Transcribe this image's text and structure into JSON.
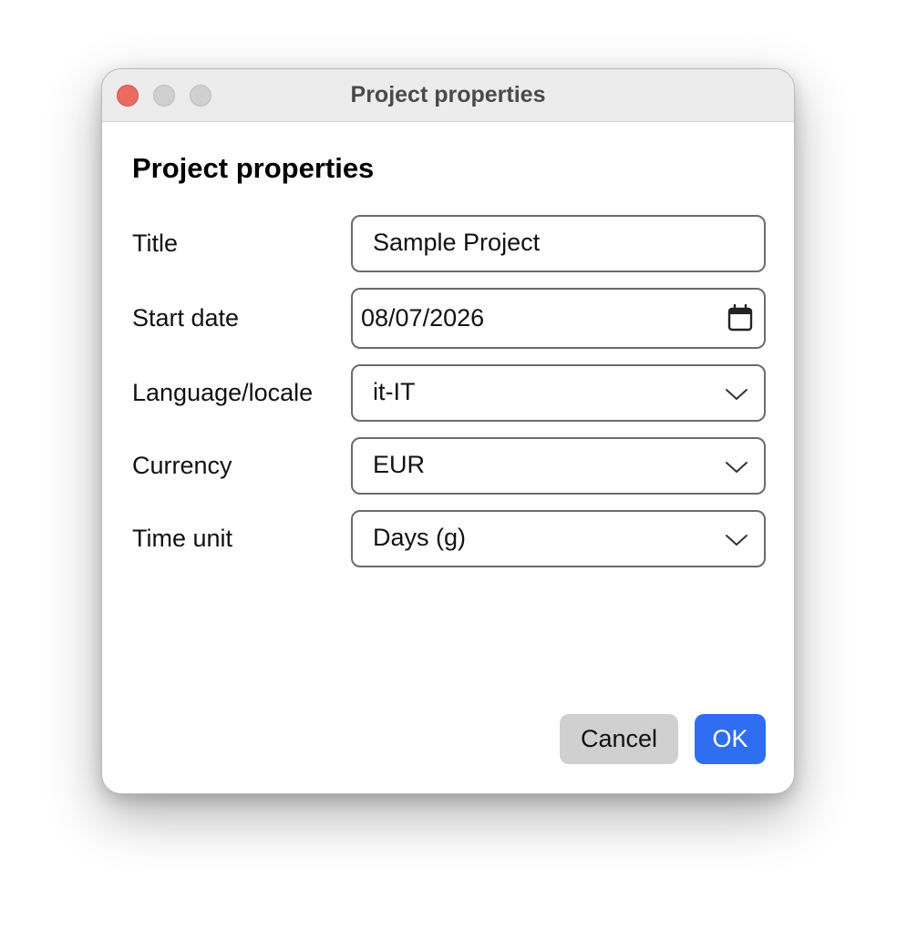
{
  "window": {
    "title": "Project properties"
  },
  "dialog": {
    "heading": "Project properties",
    "fields": [
      {
        "label": "Title",
        "value": "Sample Project",
        "kind": "text"
      },
      {
        "label": "Start date",
        "value": "08/07/2026",
        "kind": "date",
        "icon": "calendar-icon"
      },
      {
        "label": "Language/locale",
        "value": "it-IT",
        "kind": "select",
        "icon": "chevron-down-icon"
      },
      {
        "label": "Currency",
        "value": "EUR",
        "kind": "select",
        "icon": "chevron-down-icon"
      },
      {
        "label": "Time unit",
        "value": "Days (g)",
        "kind": "select",
        "icon": "chevron-down-icon"
      }
    ]
  },
  "buttons": {
    "cancel_label": "Cancel",
    "ok_label": "OK"
  },
  "colors": {
    "accent": "#2f6ef0",
    "close_button": "#ec6a5e",
    "titlebar": "#ececec",
    "cancel_bg": "#d0d0d0"
  }
}
